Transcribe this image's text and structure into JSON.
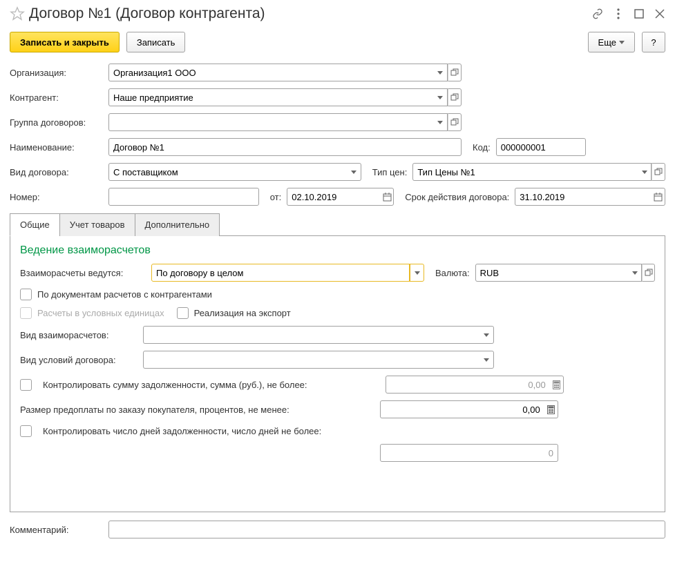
{
  "header": {
    "title": "Договор №1 (Договор контрагента)"
  },
  "toolbar": {
    "save_close": "Записать и закрыть",
    "save": "Записать",
    "more": "Еще",
    "help": "?"
  },
  "labels": {
    "organization": "Организация:",
    "counterparty": "Контрагент:",
    "contract_group": "Группа договоров:",
    "name": "Наименование:",
    "code": "Код:",
    "contract_type": "Вид договора:",
    "price_type": "Тип цен:",
    "number": "Номер:",
    "from": "от:",
    "valid_until": "Срок действия договора:",
    "comment": "Комментарий:"
  },
  "values": {
    "organization": "Организация1 ООО",
    "counterparty": "Наше предприятие",
    "contract_group": "",
    "name": "Договор №1",
    "code": "000000001",
    "contract_type": "С поставщиком",
    "price_type": "Тип Цены №1",
    "number": "",
    "from": "02.10.2019",
    "valid_until": "31.10.2019",
    "comment": ""
  },
  "tabs": {
    "general": "Общие",
    "goods": "Учет товаров",
    "extra": "Дополнительно"
  },
  "general": {
    "section_title": "Ведение взаиморасчетов",
    "settlements_label": "Взаиморасчеты ведутся:",
    "settlements_value": "По договору в целом",
    "currency_label": "Валюта:",
    "currency_value": "RUB",
    "by_documents": "По документам расчетов с контрагентами",
    "conventional_units": "Расчеты в условных единицах",
    "export_sale": "Реализация на экспорт",
    "settlement_kind_label": "Вид взаиморасчетов:",
    "settlement_kind_value": "",
    "contract_terms_label": "Вид условий договора:",
    "contract_terms_value": "",
    "control_debt_sum": "Контролировать сумму задолженности,  сумма (руб.), не более:",
    "control_debt_sum_value": "0,00",
    "prepayment_label": "Размер предоплаты по заказу покупателя, процентов, не менее:",
    "prepayment_value": "0,00",
    "control_days": "Контролировать число дней задолженности,  число дней не более:",
    "control_days_value": "0"
  }
}
